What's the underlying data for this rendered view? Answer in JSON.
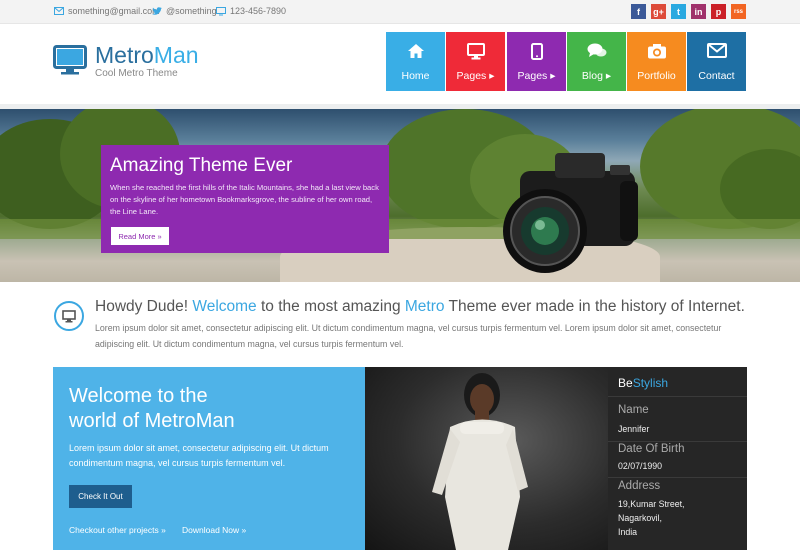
{
  "topbar": {
    "email": "something@gmail.com",
    "twitter": "@something",
    "phone": "123-456-7890",
    "social": [
      {
        "name": "facebook-icon",
        "glyph": "f",
        "color": "#3b5998"
      },
      {
        "name": "googleplus-icon",
        "glyph": "g+",
        "color": "#dd4b39"
      },
      {
        "name": "twitter-icon",
        "glyph": "t",
        "color": "#2aa9e0"
      },
      {
        "name": "linkedin-icon",
        "glyph": "in",
        "color": "#a0316b"
      },
      {
        "name": "pinterest-icon",
        "glyph": "p",
        "color": "#cb2027"
      },
      {
        "name": "rss-icon",
        "glyph": "rss",
        "color": "#f26522"
      }
    ]
  },
  "brand": {
    "title_main": "Metro",
    "title_accent": "Man",
    "tagline": "Cool Metro Theme"
  },
  "nav": [
    {
      "label": "Home",
      "icon": "home-icon",
      "color": "#39aee6"
    },
    {
      "label": "Pages ▸",
      "icon": "monitor-icon",
      "color": "#ef2a38"
    },
    {
      "label": "Pages ▸",
      "icon": "tablet-icon",
      "color": "#8e2ab0"
    },
    {
      "label": "Blog ▸",
      "icon": "chat-icon",
      "color": "#44b549"
    },
    {
      "label": "Portfolio",
      "icon": "camera-icon",
      "color": "#f68b1f"
    },
    {
      "label": "Contact",
      "icon": "mail-icon",
      "color": "#1e6fa4"
    }
  ],
  "slider": {
    "title": "Amazing Theme Ever",
    "text": "When she reached the first hills of the Italic Mountains, she had a last view back on the skyline of her hometown Bookmarksgrove, the subline of her own road, the Line Lane.",
    "button": "Read More »"
  },
  "intro": {
    "p1": "Howdy Dude! ",
    "hl1": "Welcome",
    "p2": " to the most amazing ",
    "hl2": "Metro",
    "p3": " Theme ever made in the history of Internet.",
    "body": "Lorem ipsum dolor sit amet, consectetur adipiscing elit. Ut dictum condimentum magna, vel cursus turpis fermentum vel. Lorem ipsum dolor sit amet, consectetur adipiscing elit. Ut dictum condimentum magna, vel cursus turpis fermentum vel."
  },
  "welcome": {
    "line1": "Welcome to the",
    "line2": "world of MetroMan",
    "text": "Lorem ipsum dolor sit amet, consectetur adipiscing elit. Ut dictum condimentum magna, vel cursus turpis fermentum vel.",
    "button": "Check It Out",
    "link1": "Checkout other projects »",
    "link2": "Download Now »"
  },
  "profile": {
    "title_main": "Be",
    "title_accent": "Stylish",
    "name_label": "Name",
    "name": "Jennifer",
    "dob_label": "Date Of Birth",
    "dob": "02/07/1990",
    "address_label": "Address",
    "address1": "19,Kumar Street,",
    "address2": "Nagarkovil,",
    "address3": "India"
  }
}
